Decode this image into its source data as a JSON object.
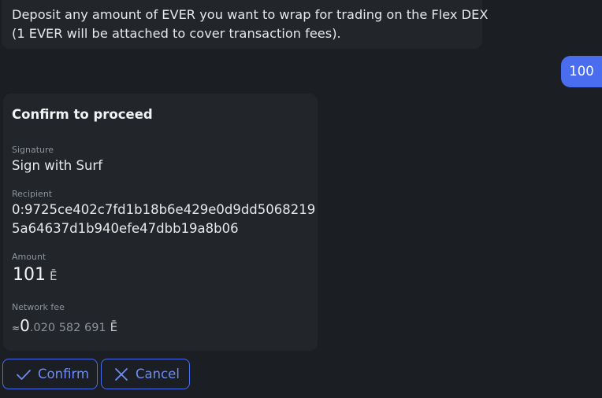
{
  "bot_message": {
    "line1": "Deposit any amount of EVER you want to wrap for trading on the Flex DEX",
    "line2": "(1 EVER will be attached to cover transaction fees)."
  },
  "user_message": "100",
  "confirm_card": {
    "title": "Confirm to proceed",
    "signature_label": "Signature",
    "signature_value": "Sign with Surf",
    "recipient_label": "Recipient",
    "recipient_line1": "0:9725ce402c7fd1b18b6e429e0d9dd5068219",
    "recipient_line2": "5a64637d1b940efe47dbb19a8b06",
    "amount_label": "Amount",
    "amount_value": "101",
    "amount_currency": "Ē",
    "fee_label": "Network fee",
    "fee_approx": "≈",
    "fee_integer": "0",
    "fee_fraction": ".020 582 691",
    "fee_currency": "Ē"
  },
  "actions": {
    "confirm_label": "Confirm",
    "cancel_label": "Cancel"
  },
  "colors": {
    "accent": "#4a6df0",
    "background": "#1b1e22",
    "card": "#22262a"
  },
  "icons": {
    "confirm": "check-icon",
    "cancel": "close-icon"
  }
}
